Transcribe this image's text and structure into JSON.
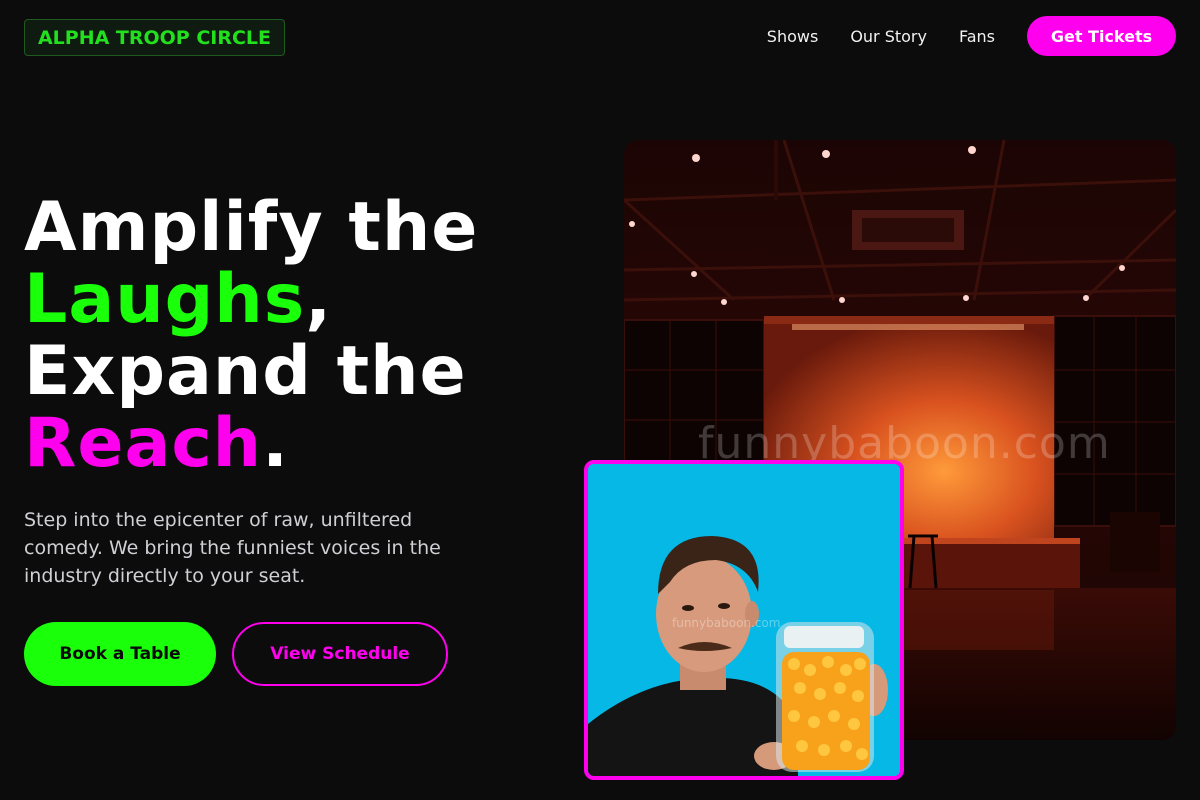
{
  "brand": {
    "name": "ALPHA TROOP CIRCLE"
  },
  "nav": {
    "items": [
      "Shows",
      "Our Story",
      "Fans"
    ],
    "cta": "Get Tickets"
  },
  "hero": {
    "line1": "Amplify the",
    "line2_highlight": "Laughs",
    "line2_punct": ",",
    "line3": "Expand the",
    "line4_highlight": "Reach",
    "line4_punct": ".",
    "lead": "Step into the epicenter of raw, unfiltered comedy. We bring the funniest voices in the industry directly to your seat.",
    "primary_button": "Book a Table",
    "secondary_button": "View Schedule"
  },
  "images": {
    "stage_watermark": "funnybaboon.com",
    "portrait_watermark": "funnybaboon.com"
  },
  "colors": {
    "background": "#0c0c0d",
    "accent_green": "#1aff0a",
    "accent_magenta": "#ff00ee"
  }
}
